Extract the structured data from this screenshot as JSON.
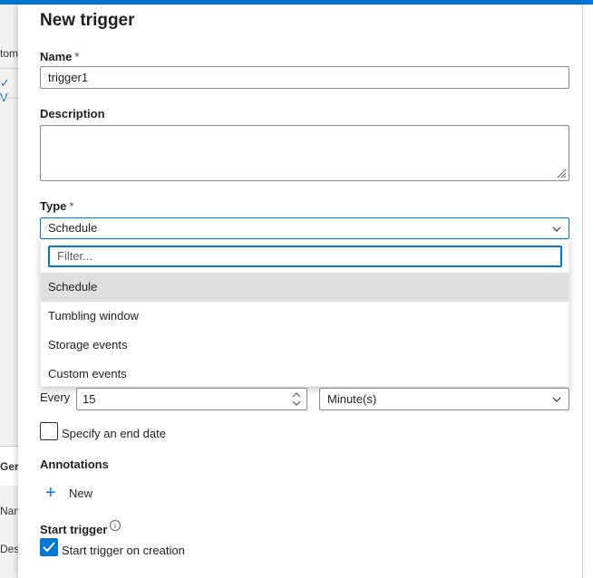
{
  "background": {
    "tab_text": "tom",
    "check_glyph": "✓ V",
    "general_tab": "Ger",
    "name_label": "Nan",
    "desc_label": "Des"
  },
  "panel": {
    "title": "New trigger",
    "name": {
      "label": "Name",
      "required": "*",
      "value": "trigger1"
    },
    "description": {
      "label": "Description",
      "value": ""
    },
    "type": {
      "label": "Type",
      "required": "*",
      "selected": "Schedule",
      "filter_placeholder": "Filter...",
      "options": [
        "Schedule",
        "Tumbling window",
        "Storage events",
        "Custom events"
      ]
    },
    "recurrence": {
      "every_label": "Every",
      "interval": "15",
      "unit": "Minute(s)"
    },
    "end_date": {
      "label": "Specify an end date",
      "checked": false
    },
    "annotations": {
      "label": "Annotations",
      "new_label": "New"
    },
    "start_trigger": {
      "label": "Start trigger",
      "checkbox_label": "Start trigger on creation",
      "checked": true
    }
  },
  "colors": {
    "accent": "#0078d4",
    "required": "#a4262c",
    "selected_option": "#e1dfdd"
  }
}
